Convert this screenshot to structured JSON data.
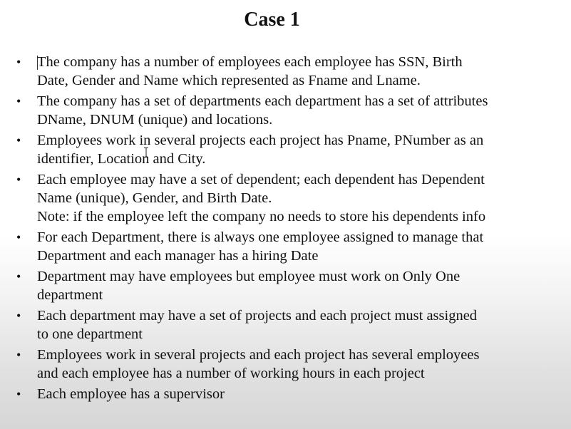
{
  "slide": {
    "title": "Case 1",
    "bullets": [
      {
        "text": "The company has a number of employees each employee has SSN, Birth\nDate, Gender and Name which represented as Fname and Lname."
      },
      {
        "text": "The company has a set of departments each department has a set of attributes\nDName, DNUM (unique) and locations."
      },
      {
        "text": "Employees work in several projects each project has Pname, PNumber as an\nidentifier, Location and City."
      },
      {
        "text": "Each employee may have a set of dependent; each dependent has Dependent\nName (unique), Gender, and Birth Date.",
        "note": "Note: if the employee left the company no needs to store his dependents info"
      },
      {
        "text": "For each Department, there is always one employee assigned to manage that\nDepartment and each manager has a hiring Date"
      },
      {
        "text": "Department may have employees but employee must work on Only One\ndepartment"
      },
      {
        "text": "Each department may have a set of projects and each project must assigned\nto one department"
      },
      {
        "text": "Employees work in several projects and each project has several employees\nand each employee has a number of working hours in each project"
      },
      {
        "text": "Each employee has a supervisor"
      }
    ]
  }
}
